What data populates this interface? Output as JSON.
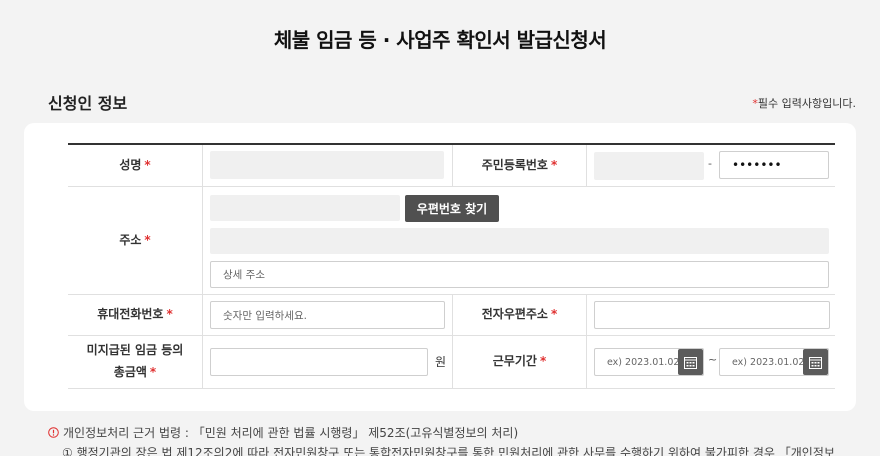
{
  "page_title": "체불 임금 등 · 사업주 확인서 발급신청서",
  "section_title": "신청인 정보",
  "required_note": {
    "star": "*",
    "text": "필수 입력사항입니다."
  },
  "form": {
    "name_label": "성명",
    "rrn_label": "주민등록번호",
    "rrn_dash": "-",
    "rrn_back_value": "•••••••",
    "address_label": "주소",
    "postcode_button": "우편번호 찾기",
    "address_detail_placeholder": "상세 주소",
    "phone_label": "휴대전화번호",
    "phone_placeholder": "숫자만 입력하세요.",
    "email_label": "전자우편주소",
    "unpaid_label_line1": "미지급된 임금 등의",
    "unpaid_label_line2": "총금액",
    "unpaid_unit": "원",
    "period_label": "근무기간",
    "period_start_placeholder": "ex) 2023.01.02",
    "period_sep": "~",
    "period_end_placeholder": "ex) 2023.01.02",
    "required_star": "*"
  },
  "notice": {
    "icon": "!",
    "line1": "개인정보처리 근거 법령 : 「민원 처리에 관한 법률 시행령」 제52조(고유식별정보의 처리)",
    "line2": "① 행정기관의 장은 법 제12조의2에 따라 전자민원창구 또는 통합전자민원창구를 통한 민원처리에 관한 사무를 수행하기 위하여 불가피한 경우 「개인정보"
  },
  "colors": {
    "required": "#e03131",
    "button": "#505050",
    "card": "#ffffff",
    "background": "#f3f3f3"
  },
  "icons": [
    "calendar-icon",
    "alert-circle-icon"
  ]
}
